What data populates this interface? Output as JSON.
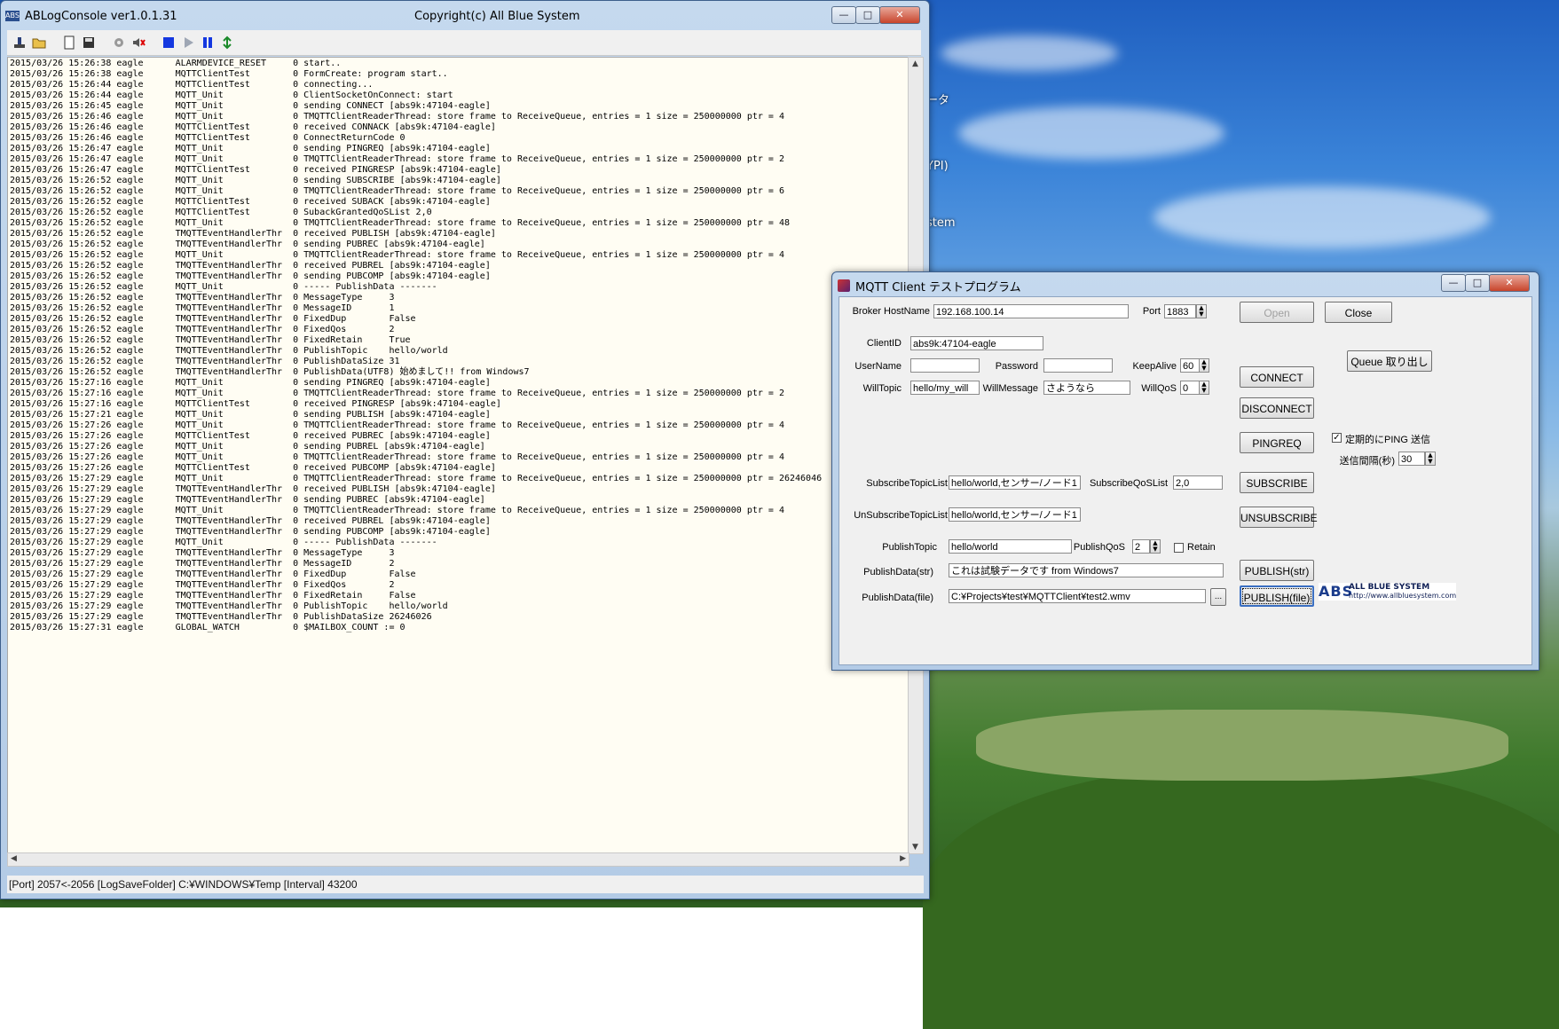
{
  "desktop": {
    "labels": [
      "ータ",
      "YPI)",
      "stem"
    ]
  },
  "log_window": {
    "title": "ABLogConsole ver1.0.1.31",
    "copyright": "Copyright(c) All Blue System",
    "toolbar_icons": [
      "connect-icon",
      "open-folder-icon",
      "new-page-icon",
      "save-icon",
      "settings-icon",
      "mute-icon",
      "stop-icon",
      "play-icon",
      "pause-icon",
      "refresh-icon"
    ],
    "log_lines": [
      "2015/03/26 15:26:38 eagle      ALARMDEVICE_RESET     0 start..",
      "2015/03/26 15:26:38 eagle      MQTTClientTest        0 FormCreate: program start..",
      "2015/03/26 15:26:44 eagle      MQTTClientTest        0 connecting...",
      "2015/03/26 15:26:44 eagle      MQTT_Unit             0 ClientSocketOnConnect: start",
      "2015/03/26 15:26:45 eagle      MQTT_Unit             0 sending CONNECT [abs9k:47104-eagle]",
      "2015/03/26 15:26:46 eagle      MQTT_Unit             0 TMQTTClientReaderThread: store frame to ReceiveQueue, entries = 1 size = 250000000 ptr = 4",
      "2015/03/26 15:26:46 eagle      MQTTClientTest        0 received CONNACK [abs9k:47104-eagle]",
      "2015/03/26 15:26:46 eagle      MQTTClientTest        0 ConnectReturnCode 0",
      "2015/03/26 15:26:47 eagle      MQTT_Unit             0 sending PINGREQ [abs9k:47104-eagle]",
      "2015/03/26 15:26:47 eagle      MQTT_Unit             0 TMQTTClientReaderThread: store frame to ReceiveQueue, entries = 1 size = 250000000 ptr = 2",
      "2015/03/26 15:26:47 eagle      MQTTClientTest        0 received PINGRESP [abs9k:47104-eagle]",
      "2015/03/26 15:26:52 eagle      MQTT_Unit             0 sending SUBSCRIBE [abs9k:47104-eagle]",
      "2015/03/26 15:26:52 eagle      MQTT_Unit             0 TMQTTClientReaderThread: store frame to ReceiveQueue, entries = 1 size = 250000000 ptr = 6",
      "2015/03/26 15:26:52 eagle      MQTTClientTest        0 received SUBACK [abs9k:47104-eagle]",
      "2015/03/26 15:26:52 eagle      MQTTClientTest        0 SubackGrantedQoSList 2,0",
      "2015/03/26 15:26:52 eagle      MQTT_Unit             0 TMQTTClientReaderThread: store frame to ReceiveQueue, entries = 1 size = 250000000 ptr = 48",
      "2015/03/26 15:26:52 eagle      TMQTTEventHandlerThr  0 received PUBLISH [abs9k:47104-eagle]",
      "2015/03/26 15:26:52 eagle      TMQTTEventHandlerThr  0 sending PUBREC [abs9k:47104-eagle]",
      "2015/03/26 15:26:52 eagle      MQTT_Unit             0 TMQTTClientReaderThread: store frame to ReceiveQueue, entries = 1 size = 250000000 ptr = 4",
      "2015/03/26 15:26:52 eagle      TMQTTEventHandlerThr  0 received PUBREL [abs9k:47104-eagle]",
      "2015/03/26 15:26:52 eagle      TMQTTEventHandlerThr  0 sending PUBCOMP [abs9k:47104-eagle]",
      "2015/03/26 15:26:52 eagle      MQTT_Unit             0 ----- PublishData -------",
      "2015/03/26 15:26:52 eagle      TMQTTEventHandlerThr  0 MessageType     3",
      "2015/03/26 15:26:52 eagle      TMQTTEventHandlerThr  0 MessageID       1",
      "2015/03/26 15:26:52 eagle      TMQTTEventHandlerThr  0 FixedDup        False",
      "2015/03/26 15:26:52 eagle      TMQTTEventHandlerThr  0 FixedQos        2",
      "2015/03/26 15:26:52 eagle      TMQTTEventHandlerThr  0 FixedRetain     True",
      "2015/03/26 15:26:52 eagle      TMQTTEventHandlerThr  0 PublishTopic    hello/world",
      "2015/03/26 15:26:52 eagle      TMQTTEventHandlerThr  0 PublishDataSize 31",
      "2015/03/26 15:26:52 eagle      TMQTTEventHandlerThr  0 PublishData(UTF8) 始めまして!! from Windows7",
      "2015/03/26 15:27:16 eagle      MQTT_Unit             0 sending PINGREQ [abs9k:47104-eagle]",
      "2015/03/26 15:27:16 eagle      MQTT_Unit             0 TMQTTClientReaderThread: store frame to ReceiveQueue, entries = 1 size = 250000000 ptr = 2",
      "2015/03/26 15:27:16 eagle      MQTTClientTest        0 received PINGRESP [abs9k:47104-eagle]",
      "2015/03/26 15:27:21 eagle      MQTT_Unit             0 sending PUBLISH [abs9k:47104-eagle]",
      "2015/03/26 15:27:26 eagle      MQTT_Unit             0 TMQTTClientReaderThread: store frame to ReceiveQueue, entries = 1 size = 250000000 ptr = 4",
      "2015/03/26 15:27:26 eagle      MQTTClientTest        0 received PUBREC [abs9k:47104-eagle]",
      "2015/03/26 15:27:26 eagle      MQTT_Unit             0 sending PUBREL [abs9k:47104-eagle]",
      "2015/03/26 15:27:26 eagle      MQTT_Unit             0 TMQTTClientReaderThread: store frame to ReceiveQueue, entries = 1 size = 250000000 ptr = 4",
      "2015/03/26 15:27:26 eagle      MQTTClientTest        0 received PUBCOMP [abs9k:47104-eagle]",
      "2015/03/26 15:27:29 eagle      MQTT_Unit             0 TMQTTClientReaderThread: store frame to ReceiveQueue, entries = 1 size = 250000000 ptr = 26246046",
      "2015/03/26 15:27:29 eagle      TMQTTEventHandlerThr  0 received PUBLISH [abs9k:47104-eagle]",
      "2015/03/26 15:27:29 eagle      TMQTTEventHandlerThr  0 sending PUBREC [abs9k:47104-eagle]",
      "2015/03/26 15:27:29 eagle      MQTT_Unit             0 TMQTTClientReaderThread: store frame to ReceiveQueue, entries = 1 size = 250000000 ptr = 4",
      "2015/03/26 15:27:29 eagle      TMQTTEventHandlerThr  0 received PUBREL [abs9k:47104-eagle]",
      "2015/03/26 15:27:29 eagle      TMQTTEventHandlerThr  0 sending PUBCOMP [abs9k:47104-eagle]",
      "2015/03/26 15:27:29 eagle      MQTT_Unit             0 ----- PublishData -------",
      "2015/03/26 15:27:29 eagle      TMQTTEventHandlerThr  0 MessageType     3",
      "2015/03/26 15:27:29 eagle      TMQTTEventHandlerThr  0 MessageID       2",
      "2015/03/26 15:27:29 eagle      TMQTTEventHandlerThr  0 FixedDup        False",
      "2015/03/26 15:27:29 eagle      TMQTTEventHandlerThr  0 FixedQos        2",
      "2015/03/26 15:27:29 eagle      TMQTTEventHandlerThr  0 FixedRetain     False",
      "2015/03/26 15:27:29 eagle      TMQTTEventHandlerThr  0 PublishTopic    hello/world",
      "2015/03/26 15:27:29 eagle      TMQTTEventHandlerThr  0 PublishDataSize 26246026",
      "2015/03/26 15:27:31 eagle      GLOBAL_WATCH          0 $MAILBOX_COUNT := 0"
    ],
    "status": "[Port] 2057<-2056   [LogSaveFolder] C:¥WINDOWS¥Temp   [Interval] 43200"
  },
  "mqtt_window": {
    "title": "MQTT Client テストプログラム",
    "broker_host": {
      "label": "Broker HostName",
      "value": "192.168.100.14"
    },
    "port": {
      "label": "Port",
      "value": "1883"
    },
    "open_button": "Open",
    "close_button": "Close",
    "client_id": {
      "label": "ClientID",
      "value": "abs9k:47104-eagle"
    },
    "username": {
      "label": "UserName",
      "value": ""
    },
    "password": {
      "label": "Password",
      "value": ""
    },
    "keepalive": {
      "label": "KeepAlive",
      "value": "60"
    },
    "will_topic": {
      "label": "WillTopic",
      "value": "hello/my_will"
    },
    "will_message": {
      "label": "WillMessage",
      "value": "さようなら"
    },
    "will_qos": {
      "label": "WillQoS",
      "value": "0"
    },
    "connect_button": "CONNECT",
    "disconnect_button": "DISCONNECT",
    "pingreq_button": "PINGREQ",
    "queue_button": "Queue 取り出し",
    "ping_checkbox": {
      "label": "定期的にPING 送信",
      "checked": true
    },
    "ping_interval": {
      "label": "送信間隔(秒)",
      "value": "30"
    },
    "subscribe_topic_list": {
      "label": "SubscribeTopicList",
      "value": "hello/world,センサー/ノード1"
    },
    "subscribe_qos_list": {
      "label": "SubscribeQoSList",
      "value": "2,0"
    },
    "subscribe_button": "SUBSCRIBE",
    "unsubscribe_topic_list": {
      "label": "UnSubscribeTopicList",
      "value": "hello/world,センサー/ノード1"
    },
    "unsubscribe_button": "UNSUBSCRIBE",
    "publish_topic": {
      "label": "PublishTopic",
      "value": "hello/world"
    },
    "publish_qos": {
      "label": "PublishQoS",
      "value": "2"
    },
    "retain": {
      "label": "Retain",
      "checked": false
    },
    "publish_data_str": {
      "label": "PublishData(str)",
      "value": "これは試験データです from Windows7"
    },
    "publish_str_button": "PUBLISH(str)",
    "publish_data_file": {
      "label": "PublishData(file)",
      "value": "C:¥Projects¥test¥MQTTClient¥test2.wmv"
    },
    "browse_button": "...",
    "publish_file_button": "PUBLISH(file)",
    "logo": {
      "mark": "ABS",
      "name": "ALL BLUE SYSTEM",
      "url": "http://www.allbluesystem.com"
    }
  },
  "colors": {
    "log_background": "#fffdf3",
    "window_frame": "#b3cbe6",
    "logo_blue": "#1b3c8c"
  }
}
